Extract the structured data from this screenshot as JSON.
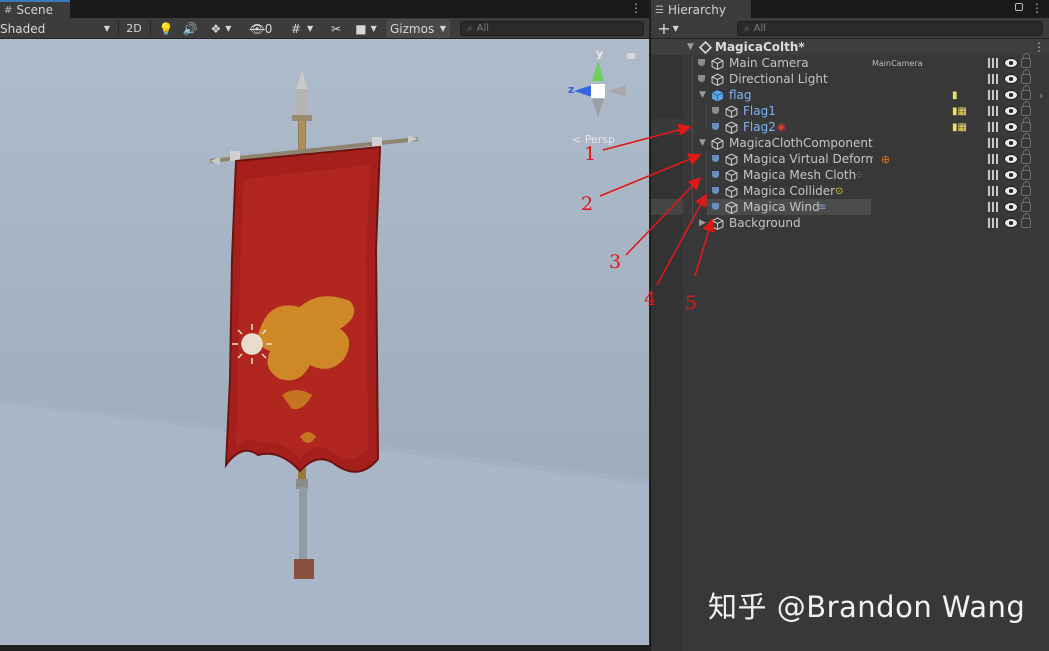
{
  "scene": {
    "tab_label": "Scene",
    "shading_mode": "Shaded",
    "mode_2d": "2D",
    "hidden_count": "0",
    "gizmos_label": "Gizmos",
    "search_placeholder": "All",
    "projection_label": "Persp",
    "axis_y": "y",
    "axis_z": "z"
  },
  "hierarchy": {
    "tab_label": "Hierarchy",
    "search_placeholder": "All",
    "scene_name": "MagicaColth*",
    "rows": [
      {
        "label": "Main Camera",
        "tag": "MainCamera"
      },
      {
        "label": "Directional Light"
      },
      {
        "label": "flag"
      },
      {
        "label": "Flag1"
      },
      {
        "label": "Flag2"
      },
      {
        "label": "MagicaClothComponent"
      },
      {
        "label": "Magica Virtual Deforme"
      },
      {
        "label": "Magica Mesh Cloth"
      },
      {
        "label": "Magica Collider"
      },
      {
        "label": "Magica Wind"
      },
      {
        "label": "Background"
      }
    ]
  },
  "annotations": [
    "1",
    "2",
    "3",
    "4",
    "5"
  ],
  "watermark": "知乎 @Brandon Wang",
  "colors": {
    "accent_blue": "#3a79bb",
    "prefab_blue": "#7eb2f2",
    "annotation_red": "#e01818",
    "panel_bg": "#383838"
  }
}
